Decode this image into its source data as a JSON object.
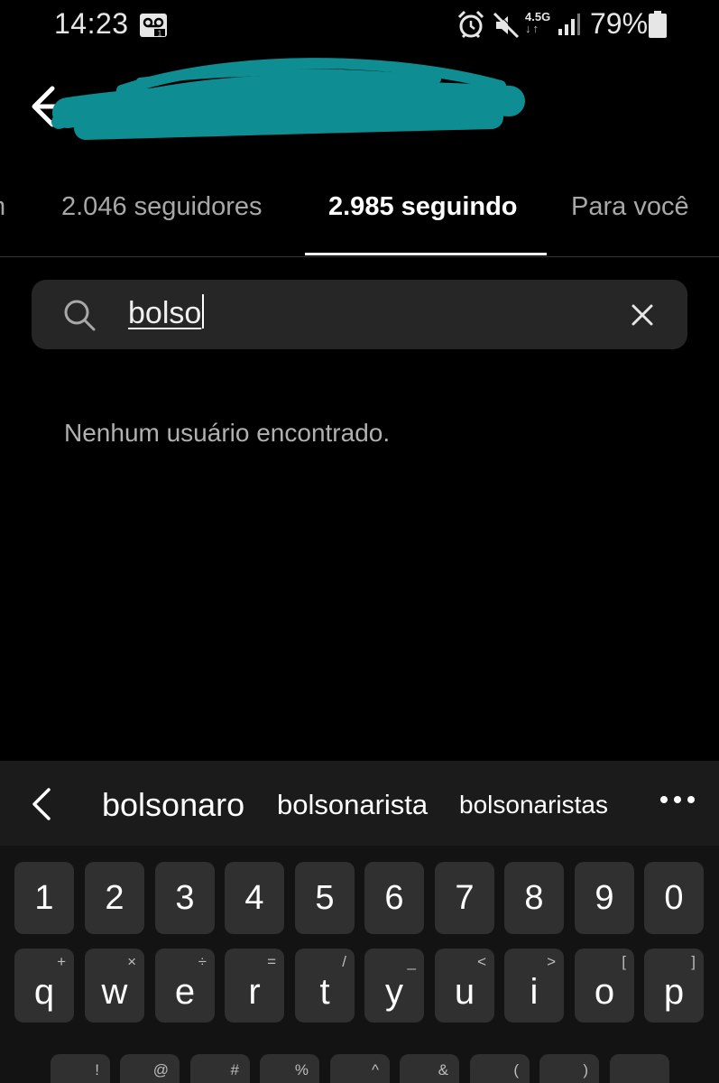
{
  "status_bar": {
    "time": "14:23",
    "network_type": "4.5G",
    "battery_percent": "79%",
    "icons": [
      "voicemail-icon",
      "alarm-icon",
      "mute-icon",
      "signal-icon",
      "battery-icon"
    ]
  },
  "header": {
    "back_icon": "arrow-left-icon",
    "username_obscured": true,
    "scribble_color": "#0e8e93"
  },
  "tabs": [
    {
      "label": "m",
      "active": false
    },
    {
      "label": "2.046 seguidores",
      "active": false
    },
    {
      "label": "2.985 seguindo",
      "active": true
    },
    {
      "label": "Para você",
      "active": false
    }
  ],
  "search": {
    "value": "bolso",
    "icon": "search-icon",
    "clear_icon": "close-icon"
  },
  "empty_message": "Nenhum usuário encontrado.",
  "keyboard": {
    "suggestions": [
      "bolsonaro",
      "bolsonarista",
      "bolsonaristas"
    ],
    "number_row": [
      "1",
      "2",
      "3",
      "4",
      "5",
      "6",
      "7",
      "8",
      "9",
      "0"
    ],
    "letter_row": [
      {
        "key": "q",
        "hint": "+"
      },
      {
        "key": "w",
        "hint": "×"
      },
      {
        "key": "e",
        "hint": "÷"
      },
      {
        "key": "r",
        "hint": "="
      },
      {
        "key": "t",
        "hint": "/"
      },
      {
        "key": "y",
        "hint": "_"
      },
      {
        "key": "u",
        "hint": "<"
      },
      {
        "key": "i",
        "hint": ">"
      },
      {
        "key": "o",
        "hint": "["
      },
      {
        "key": "p",
        "hint": "]"
      }
    ],
    "partial_row_hints": [
      "!",
      "@",
      "#",
      "%",
      "^",
      "&",
      "(",
      ")"
    ]
  },
  "colors": {
    "background": "#000000",
    "search_bg": "#262626",
    "key_bg": "#303030",
    "keyboard_bg": "#131313",
    "accent_scribble": "#0e8e93"
  }
}
